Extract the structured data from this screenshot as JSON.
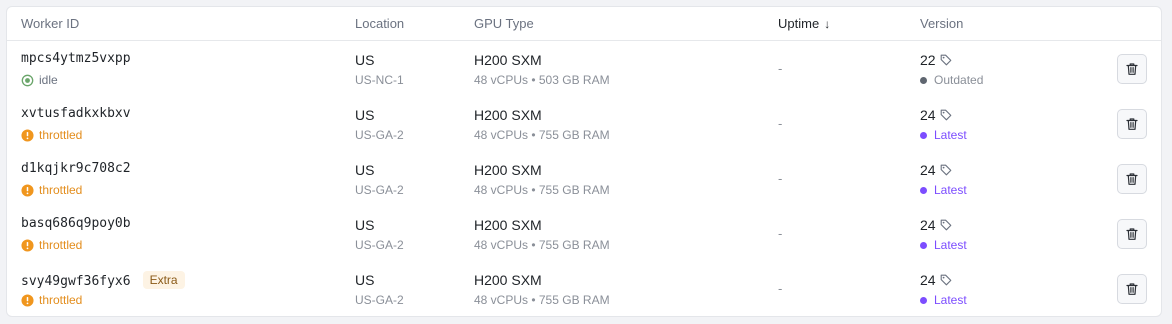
{
  "columns": {
    "worker_id": "Worker ID",
    "location": "Location",
    "gpu_type": "GPU Type",
    "uptime": "Uptime",
    "uptime_sort": "↓",
    "version": "Version"
  },
  "colors": {
    "idle": "#6aa56a",
    "throttled": "#f0961e",
    "outdated_dot": "#5f6670",
    "latest": "#7c4dff"
  },
  "rows": [
    {
      "id": "mpcs4ytmz5vxpp",
      "badge": "",
      "status": "idle",
      "country": "US",
      "region": "US-NC-1",
      "gpu": "H200 SXM",
      "specs": "48 vCPUs • 503 GB RAM",
      "uptime": "-",
      "version": "22",
      "version_status": "Outdated"
    },
    {
      "id": "xvtusfadkxkbxv",
      "badge": "",
      "status": "throttled",
      "country": "US",
      "region": "US-GA-2",
      "gpu": "H200 SXM",
      "specs": "48 vCPUs • 755 GB RAM",
      "uptime": "-",
      "version": "24",
      "version_status": "Latest"
    },
    {
      "id": "d1kqjkr9c708c2",
      "badge": "",
      "status": "throttled",
      "country": "US",
      "region": "US-GA-2",
      "gpu": "H200 SXM",
      "specs": "48 vCPUs • 755 GB RAM",
      "uptime": "-",
      "version": "24",
      "version_status": "Latest"
    },
    {
      "id": "basq686q9poy0b",
      "badge": "",
      "status": "throttled",
      "country": "US",
      "region": "US-GA-2",
      "gpu": "H200 SXM",
      "specs": "48 vCPUs • 755 GB RAM",
      "uptime": "-",
      "version": "24",
      "version_status": "Latest"
    },
    {
      "id": "svy49gwf36fyx6",
      "badge": "Extra",
      "status": "throttled",
      "country": "US",
      "region": "US-GA-2",
      "gpu": "H200 SXM",
      "specs": "48 vCPUs • 755 GB RAM",
      "uptime": "-",
      "version": "24",
      "version_status": "Latest"
    }
  ]
}
